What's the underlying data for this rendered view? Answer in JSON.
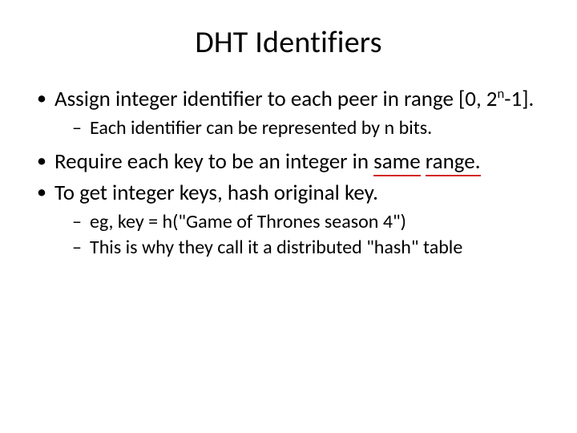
{
  "slide": {
    "title": "DHT Identifiers",
    "bullets": [
      {
        "text_a": "Assign integer identifier to each peer in range [0, 2",
        "sup": "n",
        "text_b": "-1].",
        "sub": [
          {
            "text": "Each identifier can be represented by n bits."
          }
        ]
      },
      {
        "text_a": "Require each key to be an integer in ",
        "hl1": "same",
        "mid": " ",
        "hl2": "range",
        "tail": "."
      },
      {
        "text_a": "To get integer keys, hash original key.",
        "sub": [
          {
            "text": "eg, key = h(\"Game of Thrones season 4\")"
          },
          {
            "text": "This is why they call it a distributed \"hash\" table"
          }
        ]
      }
    ]
  }
}
